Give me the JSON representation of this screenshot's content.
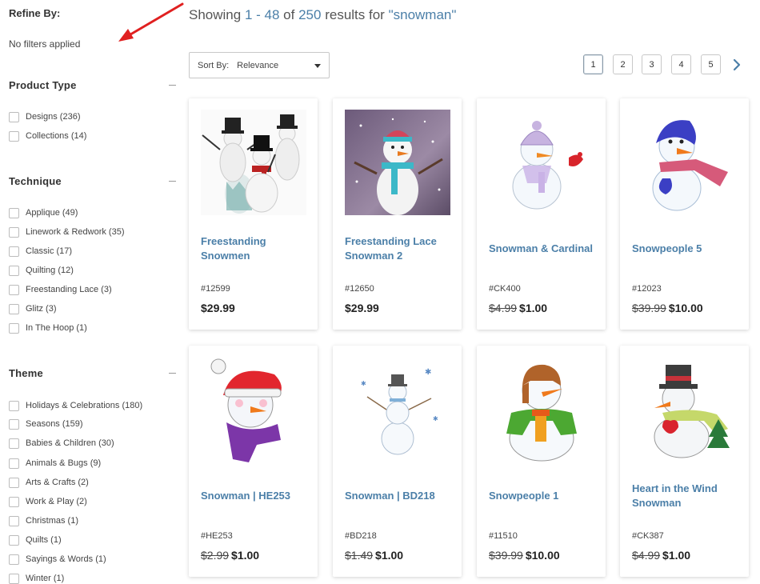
{
  "sidebar": {
    "refine_title": "Refine By:",
    "no_filters": "No filters applied",
    "sections": [
      {
        "title": "Product Type",
        "options": [
          "Designs (236)",
          "Collections (14)"
        ]
      },
      {
        "title": "Technique",
        "options": [
          "Applique (49)",
          "Linework & Redwork (35)",
          "Classic (17)",
          "Quilting (12)",
          "Freestanding Lace (3)",
          "Glitz (3)",
          "In The Hoop (1)"
        ]
      },
      {
        "title": "Theme",
        "options": [
          "Holidays & Celebrations (180)",
          "Seasons (159)",
          "Babies & Children (30)",
          "Animals & Bugs (9)",
          "Arts & Crafts (2)",
          "Work & Play (2)",
          "Christmas (1)",
          "Quilts (1)",
          "Sayings & Words (1)",
          "Winter (1)"
        ]
      }
    ]
  },
  "results": {
    "showing": "Showing",
    "range": "1 - 48",
    "of": "of",
    "total": "250",
    "results_for": "results for",
    "query": "\"snowman\""
  },
  "sort": {
    "label": "Sort By:",
    "value": "Relevance"
  },
  "pagination": {
    "pages": [
      "1",
      "2",
      "3",
      "4",
      "5"
    ],
    "active_page": "1"
  },
  "products": [
    {
      "name": "Freestanding Snowmen",
      "sku": "#12599",
      "old_price": "",
      "price": "$29.99"
    },
    {
      "name": "Freestanding Lace Snowman 2",
      "sku": "#12650",
      "old_price": "",
      "price": "$29.99"
    },
    {
      "name": "Snowman & Cardinal",
      "sku": "#CK400",
      "old_price": "$4.99",
      "price": "$1.00"
    },
    {
      "name": "Snowpeople 5",
      "sku": "#12023",
      "old_price": "$39.99",
      "price": "$10.00"
    },
    {
      "name": "Snowman | HE253",
      "sku": "#HE253",
      "old_price": "$2.99",
      "price": "$1.00"
    },
    {
      "name": "Snowman | BD218",
      "sku": "#BD218",
      "old_price": "$1.49",
      "price": "$1.00"
    },
    {
      "name": "Snowpeople 1",
      "sku": "#11510",
      "old_price": "$39.99",
      "price": "$10.00"
    },
    {
      "name": "Heart in the Wind Snowman",
      "sku": "#CK387",
      "old_price": "$4.99",
      "price": "$1.00"
    }
  ],
  "colors": {
    "link": "#4b7fa8",
    "annotation_arrow": "#e02020"
  }
}
